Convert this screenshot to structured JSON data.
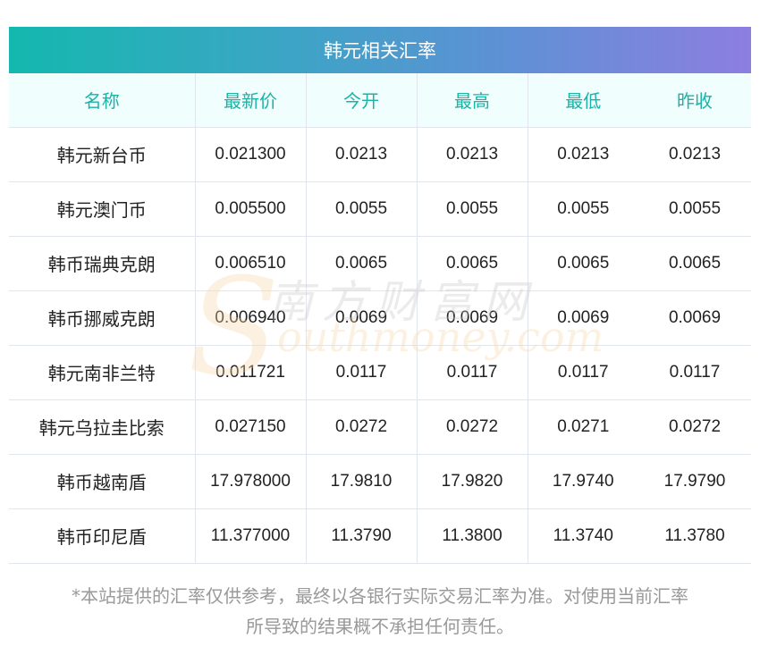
{
  "title": "韩元相关汇率",
  "table": {
    "headers": [
      "名称",
      "最新价",
      "今开",
      "最高",
      "最低",
      "昨收"
    ],
    "rows": [
      [
        "韩元新台币",
        "0.021300",
        "0.0213",
        "0.0213",
        "0.0213",
        "0.0213"
      ],
      [
        "韩元澳门币",
        "0.005500",
        "0.0055",
        "0.0055",
        "0.0055",
        "0.0055"
      ],
      [
        "韩币瑞典克朗",
        "0.006510",
        "0.0065",
        "0.0065",
        "0.0065",
        "0.0065"
      ],
      [
        "韩币挪威克朗",
        "0.006940",
        "0.0069",
        "0.0069",
        "0.0069",
        "0.0069"
      ],
      [
        "韩元南非兰特",
        "0.011721",
        "0.0117",
        "0.0117",
        "0.0117",
        "0.0117"
      ],
      [
        "韩元乌拉圭比索",
        "0.027150",
        "0.0272",
        "0.0272",
        "0.0271",
        "0.0272"
      ],
      [
        "韩币越南盾",
        "17.978000",
        "17.9810",
        "17.9820",
        "17.9740",
        "17.9790"
      ],
      [
        "韩币印尼盾",
        "11.377000",
        "11.3790",
        "11.3800",
        "11.3740",
        "11.3780"
      ]
    ]
  },
  "watermark": {
    "cn": "南方财富网",
    "en": "southmoney.com"
  },
  "disclaimer": {
    "line1": "*本站提供的汇率仅供参考，最终以各银行实际交易汇率为准。对使用当前汇率",
    "line2": "所导致的结果概不承担任何责任。"
  }
}
